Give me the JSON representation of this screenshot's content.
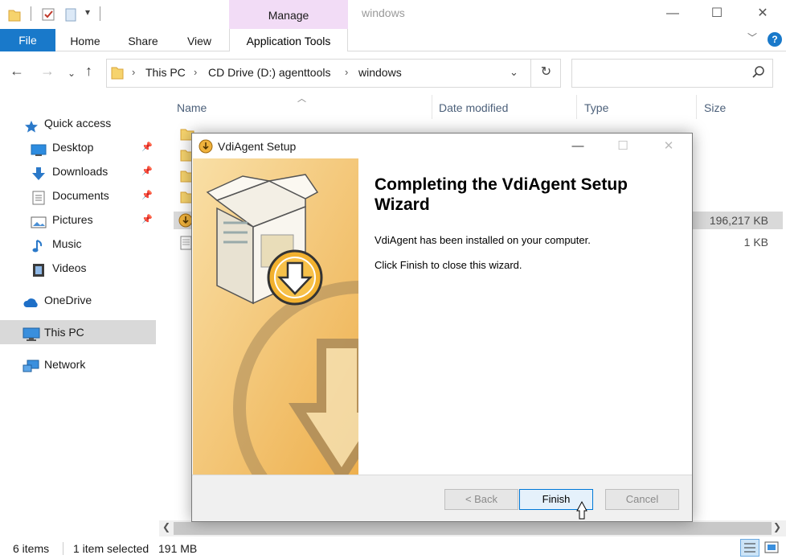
{
  "titlebar": {
    "context_tab": "Manage",
    "window_title": "windows",
    "minimize": "—",
    "maximize": "☐",
    "close": "✕"
  },
  "ribbon": {
    "tabs": [
      "File",
      "Home",
      "Share",
      "View",
      "Application Tools"
    ],
    "help": "?"
  },
  "address": {
    "crumbs": [
      "This PC",
      "CD Drive (D:) agenttools",
      "windows"
    ],
    "search_placeholder": ""
  },
  "sidebar": {
    "items": [
      {
        "label": "Quick access",
        "icon": "star-icon"
      },
      {
        "label": "Desktop",
        "icon": "desktop-icon",
        "pinned": true
      },
      {
        "label": "Downloads",
        "icon": "download-icon",
        "pinned": true
      },
      {
        "label": "Documents",
        "icon": "document-icon",
        "pinned": true
      },
      {
        "label": "Pictures",
        "icon": "picture-icon",
        "pinned": true
      },
      {
        "label": "Music",
        "icon": "music-icon"
      },
      {
        "label": "Videos",
        "icon": "video-icon"
      },
      {
        "label": "OneDrive",
        "icon": "cloud-icon"
      },
      {
        "label": "This PC",
        "icon": "computer-icon",
        "selected": true
      },
      {
        "label": "Network",
        "icon": "network-icon"
      }
    ]
  },
  "filelist": {
    "columns": [
      "Name",
      "Date modified",
      "Type",
      "Size"
    ],
    "rows": [
      {
        "size": ""
      },
      {
        "size": ""
      },
      {
        "size": ""
      },
      {
        "size": ""
      },
      {
        "size": "196,217 KB",
        "selected": true
      },
      {
        "size": "1 KB"
      }
    ]
  },
  "status": {
    "items": "6 items",
    "selection": "1 item selected",
    "size": "191 MB"
  },
  "dialog": {
    "title": "VdiAgent Setup",
    "heading": "Completing the VdiAgent Setup Wizard",
    "line1": "VdiAgent has been installed on your computer.",
    "line2": "Click Finish to close this wizard.",
    "back_label": "< Back",
    "finish_label": "Finish",
    "cancel_label": "Cancel"
  },
  "colors": {
    "accent": "#1979ca",
    "manage_tab": "#f2dcf6",
    "banner": "#f3c36a"
  }
}
